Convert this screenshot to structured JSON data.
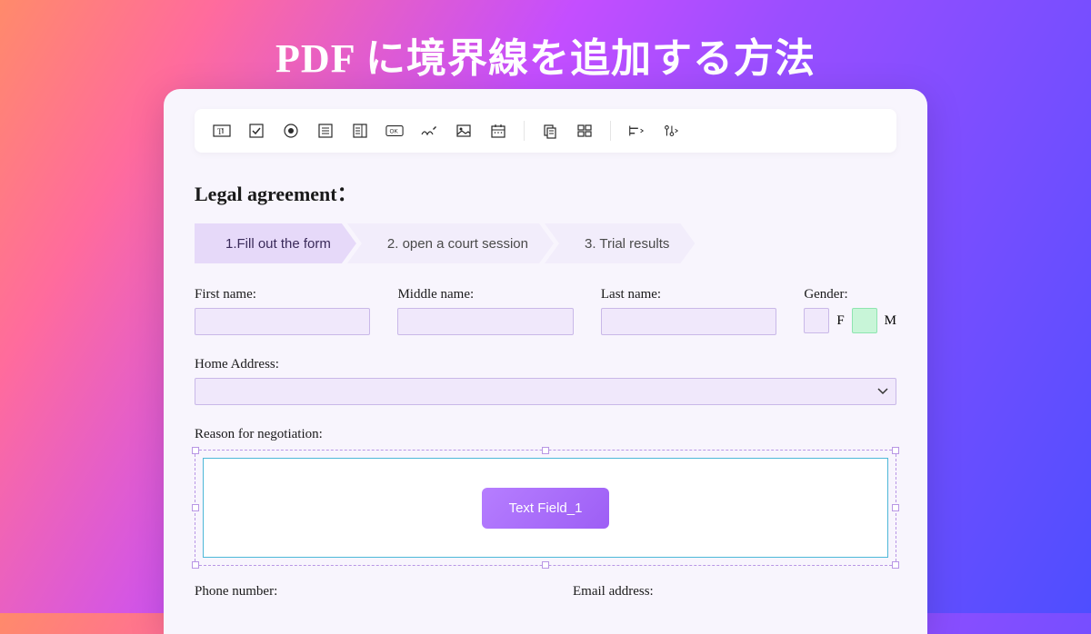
{
  "page_title": "PDF に境界線を追加する方法",
  "document_title": "Legal agreement：",
  "steps": [
    {
      "label": "1.Fill out the form",
      "active": true
    },
    {
      "label": "2. open a court session",
      "active": false
    },
    {
      "label": "3. Trial results",
      "active": false
    }
  ],
  "fields": {
    "first_name": "First name:",
    "middle_name": "Middle name:",
    "last_name": "Last name:",
    "gender": "Gender:",
    "gender_f": "F",
    "gender_m": "M",
    "home_address": "Home Address:",
    "reason": "Reason for negotiation:",
    "phone": "Phone number:",
    "email": "Email address:"
  },
  "selected_field_label": "Text Field_1",
  "toolbar_icons": [
    "text-field-icon",
    "checkbox-icon",
    "radio-icon",
    "list-icon",
    "combo-icon",
    "ok-button-icon",
    "signature-icon",
    "image-icon",
    "date-icon",
    "copy-icon",
    "grid-icon",
    "align-icon",
    "tools-icon"
  ],
  "colors": {
    "accent": "#9d5ef5",
    "field_bg": "#f0e8fb",
    "field_border": "#c9b8e8",
    "selection": "#b896e5",
    "active_step": "#e6d9f9"
  }
}
